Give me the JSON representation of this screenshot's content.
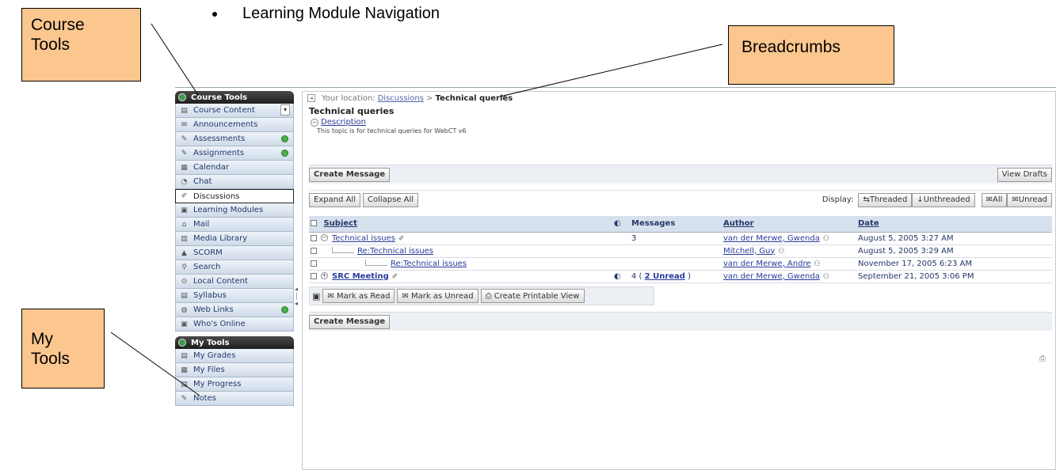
{
  "bullet": {
    "text": "Learning Module Navigation"
  },
  "callouts": {
    "course_tools": "Course Tools",
    "breadcrumbs": "Breadcrumbs",
    "my_tools": "My Tools"
  },
  "sidebar": {
    "course_heading": "Course Tools",
    "items": [
      {
        "label": "Course Content",
        "icon": "course-content-icon"
      },
      {
        "label": "Announcements",
        "icon": "announcements-icon"
      },
      {
        "label": "Assessments",
        "icon": "assessments-icon"
      },
      {
        "label": "Assignments",
        "icon": "assignments-icon"
      },
      {
        "label": "Calendar",
        "icon": "calendar-icon"
      },
      {
        "label": "Chat",
        "icon": "chat-icon"
      },
      {
        "label": "Discussions",
        "icon": "discussions-icon"
      },
      {
        "label": "Learning Modules",
        "icon": "learning-modules-icon"
      },
      {
        "label": "Mail",
        "icon": "mail-icon"
      },
      {
        "label": "Media Library",
        "icon": "media-library-icon"
      },
      {
        "label": "SCORM",
        "icon": "scorm-icon"
      },
      {
        "label": "Search",
        "icon": "search-icon"
      },
      {
        "label": "Local Content",
        "icon": "local-content-icon"
      },
      {
        "label": "Syllabus",
        "icon": "syllabus-icon"
      },
      {
        "label": "Web Links",
        "icon": "web-links-icon"
      },
      {
        "label": "Who's Online",
        "icon": "whos-online-icon"
      }
    ],
    "my_heading": "My Tools",
    "my_items": [
      {
        "label": "My Grades",
        "icon": "grades-icon"
      },
      {
        "label": "My Files",
        "icon": "files-icon"
      },
      {
        "label": "My Progress",
        "icon": "progress-icon"
      },
      {
        "label": "Notes",
        "icon": "notes-icon"
      }
    ]
  },
  "breadcrumb": {
    "prefix": "Your location:",
    "link": "Discussions",
    "separator": ">",
    "current": "Technical queries"
  },
  "topic": {
    "title": "Technical queries",
    "description_link": "Description",
    "description_text": "This topic is for technical queries for WebCT v6"
  },
  "toolbar": {
    "create_message": "Create Message",
    "view_drafts": "View Drafts",
    "expand_all": "Expand All",
    "collapse_all": "Collapse All",
    "display_label": "Display:",
    "threaded": "Threaded",
    "unthreaded": "Unthreaded",
    "all": "All",
    "unread": "Unread"
  },
  "table": {
    "headers": {
      "subject": "Subject",
      "messages": "Messages",
      "author": "Author",
      "date": "Date"
    },
    "rows": [
      {
        "toggle": "−",
        "subject": "Technical issues",
        "messages": "3",
        "author": "van der Merwe, Gwenda",
        "date": "August 5, 2005 3:27 AM"
      },
      {
        "toggle": "",
        "subject": "Re:Technical issues",
        "messages": "",
        "author": "Mitchell, Guy",
        "date": "August 5, 2005 3:29 AM"
      },
      {
        "toggle": "",
        "subject": "Re:Technical issues",
        "messages": "",
        "author": "van der Merwe, Andre",
        "date": "November 17, 2005 6:23 AM"
      },
      {
        "toggle": "+",
        "subject": "SRC Meeting",
        "messages_count": "4",
        "messages_unread": "2 Unread",
        "author": "van der Merwe, Gwenda",
        "date": "September 21, 2005 3:06 PM"
      }
    ]
  },
  "actions": {
    "mark_read": "Mark as Read",
    "mark_unread": "Mark as Unread",
    "printable": "Create Printable View"
  },
  "bottom": {
    "create_message": "Create Message"
  }
}
